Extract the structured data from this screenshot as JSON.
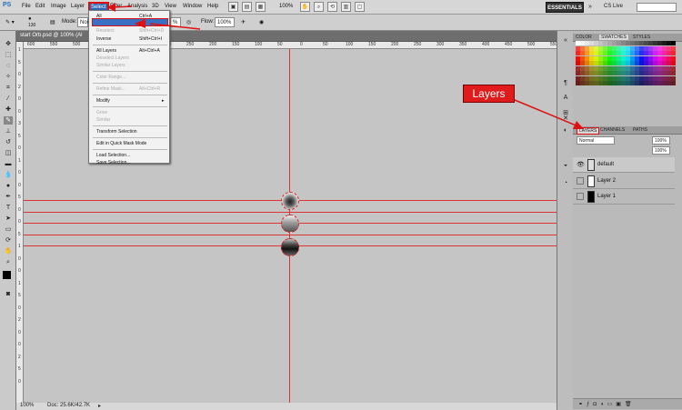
{
  "app": {
    "logo": "PS"
  },
  "menu": [
    "File",
    "Edit",
    "Image",
    "Layer",
    "Select",
    "Filter",
    "Analysis",
    "3D",
    "View",
    "Window",
    "Help"
  ],
  "zoom_toolbar": "100%",
  "workspace": "ESSENTIALS",
  "cslive": "CS Live",
  "options": {
    "mode_label": "Mode:",
    "mode_value": "Nor",
    "brush_size": "130",
    "opacity_value": "%",
    "flow_label": "Flow:",
    "flow_value": "100%"
  },
  "document": {
    "tab": "start Orb.psd @ 100% (Al"
  },
  "ruler_labels": [
    "600",
    "550",
    "500",
    "450",
    "400",
    "350",
    "300",
    "250",
    "200",
    "150",
    "100",
    "50",
    "0",
    "50",
    "100",
    "150",
    "200",
    "250",
    "300",
    "350",
    "400",
    "450",
    "500",
    "550"
  ],
  "ruler_v_labels": [
    "1",
    "5",
    "0",
    "2",
    "0",
    "0",
    "3",
    "5",
    "0",
    "1",
    "0",
    "0",
    "5",
    "0",
    "0",
    "5",
    "1",
    "0",
    "0",
    "1",
    "5",
    "0",
    "2",
    "0",
    "0",
    "2",
    "5",
    "0"
  ],
  "status": {
    "zoom": "100%",
    "doc": "Doc: 25.6K/42.7K"
  },
  "select_menu": {
    "items": [
      {
        "label": "All",
        "shortcut": "Ctrl+A",
        "disabled": false
      },
      {
        "label": "Deselect",
        "shortcut": "Ctrl+D",
        "disabled": false
      },
      {
        "label": "Reselect",
        "shortcut": "Shift+Ctrl+D",
        "disabled": true
      },
      {
        "label": "Inverse",
        "shortcut": "Shift+Ctrl+I",
        "disabled": false
      },
      {
        "label": "All Layers",
        "shortcut": "Alt+Ctrl+A",
        "disabled": false
      },
      {
        "label": "Deselect Layers",
        "shortcut": "",
        "disabled": true
      },
      {
        "label": "Similar Layers",
        "shortcut": "",
        "disabled": true
      },
      {
        "label": "Color Range...",
        "shortcut": "",
        "disabled": true
      },
      {
        "label": "Refine Mask...",
        "shortcut": "Alt+Ctrl+R",
        "disabled": true
      },
      {
        "label": "Modify",
        "shortcut": "",
        "disabled": false
      },
      {
        "label": "Grow",
        "shortcut": "",
        "disabled": true
      },
      {
        "label": "Similar",
        "shortcut": "",
        "disabled": true
      },
      {
        "label": "Transform Selection",
        "shortcut": "",
        "disabled": false
      },
      {
        "label": "Edit in Quick Mask Mode",
        "shortcut": "",
        "disabled": false
      },
      {
        "label": "Load Selection...",
        "shortcut": "",
        "disabled": false
      },
      {
        "label": "Save Selection...",
        "shortcut": "",
        "disabled": false
      }
    ]
  },
  "panels": {
    "color_tabs": [
      "COLOR",
      "SWATCHES",
      "STYLES"
    ],
    "layer_tabs": [
      "LAYERS",
      "CHANNELS",
      "PATHS"
    ],
    "blend_mode": "Normal",
    "opacity": "100%",
    "fill": "100%",
    "layers": [
      {
        "name": "default",
        "visible": true
      },
      {
        "name": "Layer 2",
        "visible": false
      },
      {
        "name": "Layer 1",
        "visible": false
      }
    ]
  },
  "callout": "Layers",
  "colors": {
    "guide": "#dd3333",
    "annotation": "#e01b1b",
    "highlight": "#3a6fc2"
  }
}
